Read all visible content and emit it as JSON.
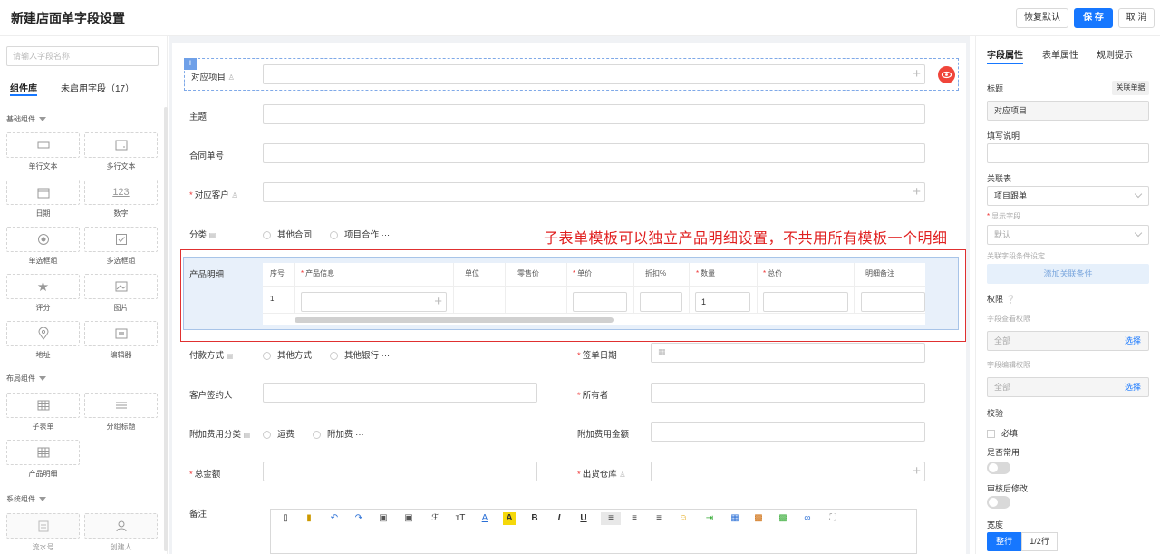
{
  "header": {
    "title": "新建店面单字段设置",
    "restore": "恢复默认",
    "save": "保 存",
    "cancel": "取 消"
  },
  "left": {
    "search_placeholder": "请输入字段名称",
    "tab_lib": "组件库",
    "tab_unused": "未启用字段（17）",
    "sec_basic": "基础组件",
    "sec_layout": "布局组件",
    "sec_system": "系统组件",
    "basic": [
      "单行文本",
      "多行文本",
      "日期",
      "数字",
      "单选框组",
      "多选框组",
      "评分",
      "图片",
      "地址",
      "编辑器"
    ],
    "layout": [
      "子表单",
      "分组标题",
      "产品明细"
    ],
    "system": [
      "流水号",
      "创建人"
    ]
  },
  "form": {
    "f1": "对应项目",
    "f2": "主题",
    "f3": "合同单号",
    "f4": "对应客户",
    "f5": "分类",
    "f5_o1": "其他合同",
    "f5_o2": "项目合作",
    "more": "···",
    "product": "产品明细",
    "cols": [
      "序号",
      "产品信息",
      "单位",
      "零售价",
      "单价",
      "折扣%",
      "数量",
      "总价",
      "明细备注"
    ],
    "row_no": "1",
    "qty": "1",
    "pay": "付款方式",
    "pay_o1": "其他方式",
    "pay_o2": "其他银行",
    "sign_date": "签单日期",
    "signer": "客户签约人",
    "owner": "所有者",
    "extra_cat": "附加费用分类",
    "extra_o1": "运费",
    "extra_o2": "附加费",
    "extra_amt": "附加费用金额",
    "total": "总金额",
    "warehouse": "出货仓库",
    "remark": "备注",
    "star": "*"
  },
  "annotation": "子表单模板可以独立产品明细设置，不共用所有模板一个明细",
  "toolbar": [
    "undo-icon",
    "redo-icon",
    "bold",
    "italic",
    "underline"
  ],
  "right": {
    "tab1": "字段属性",
    "tab2": "表单属性",
    "tab3": "规则提示",
    "title_label": "标题",
    "assoc_btn": "关联单据",
    "title_value": "对应项目",
    "desc_label": "填写说明",
    "rel_table_label": "关联表",
    "rel_table_value": "项目跟单",
    "display_label": "显示字段",
    "display_value": "默认",
    "cond_label": "关联字段条件设定",
    "add_cond": "添加关联条件",
    "perm_label": "权限",
    "view_perm": "字段查看权限",
    "all": "全部",
    "choose": "选择",
    "edit_perm": "字段编辑权限",
    "validate": "校验",
    "required": "必填",
    "common": "是否常用",
    "after_audit": "审核后修改",
    "width": "宽度",
    "w_full": "整行",
    "w_half": "1/2行"
  },
  "colors": {
    "accent": "#1677ff",
    "red": "#e02020"
  }
}
